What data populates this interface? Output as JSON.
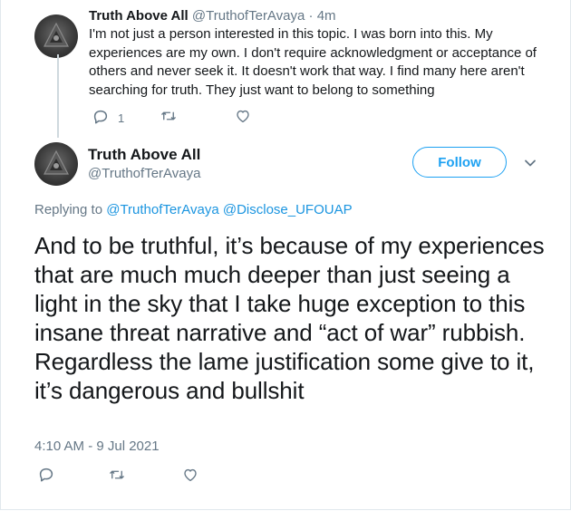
{
  "parent_tweet": {
    "display_name": "Truth Above All",
    "handle": "@TruthofTerAvaya",
    "separator": "·",
    "time": "4m",
    "text": "I'm not just a person interested in this topic. I was born into this. My experiences are my own. I don't require acknowledgment or acceptance of others and never seek it. It doesn't work that way. I find many here aren't searching for truth. They just want to belong to something",
    "reply_count": "1",
    "icons": [
      "reply-icon",
      "retweet-icon",
      "like-icon"
    ]
  },
  "main_tweet": {
    "display_name": "Truth Above All",
    "handle": "@TruthofTerAvaya",
    "follow_label": "Follow",
    "replying_prefix": "Replying to ",
    "mention_1": "@TruthofTerAvaya",
    "mention_2": "@Disclose_UFOUAP",
    "text": "And to be truthful, it’s because of my experiences that are much much deeper than just seeing a light in the sky that I take huge exception to this insane threat narrative and “act of war” rubbish. Regardless the lame justification some give to it, it’s dangerous and bullshit",
    "timestamp": "4:10 AM - 9 Jul 2021",
    "icons": [
      "reply-icon",
      "retweet-icon",
      "like-icon",
      "chevron-down-icon"
    ]
  },
  "colors": {
    "accent": "#1da1f2",
    "secondary_text": "#657786",
    "primary_text": "#14171a"
  }
}
